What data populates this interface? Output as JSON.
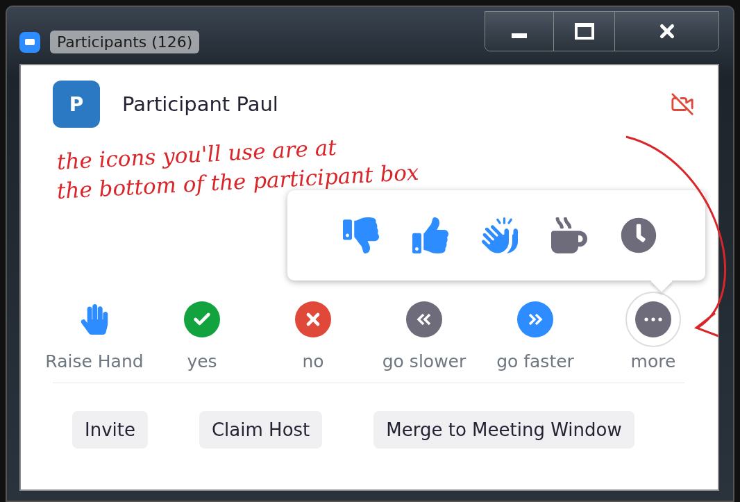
{
  "window": {
    "title": "Participants (126)"
  },
  "participant": {
    "initial": "P",
    "name": "Participant Paul"
  },
  "annotation": {
    "lines": [
      "the icons you'll use are at",
      "the bottom of the participant box"
    ]
  },
  "reactions": [
    {
      "kind": "thumbs-down",
      "color": "#2d8cff"
    },
    {
      "kind": "thumbs-up",
      "color": "#2d8cff"
    },
    {
      "kind": "clap",
      "color": "#2d8cff"
    },
    {
      "kind": "coffee",
      "color": "#6e6c7b"
    },
    {
      "kind": "clock",
      "color": "#6e6c7b"
    }
  ],
  "feedback": [
    {
      "kind": "hand",
      "label": "Raise Hand",
      "color": "#2d8cff"
    },
    {
      "kind": "check",
      "label": "yes",
      "color": "#12a23e"
    },
    {
      "kind": "cross",
      "label": "no",
      "color": "#e0493a"
    },
    {
      "kind": "slower",
      "label": "go slower",
      "color": "#6e6c7b"
    },
    {
      "kind": "faster",
      "label": "go faster",
      "color": "#2d8cff"
    },
    {
      "kind": "more",
      "label": "more",
      "color": "#6e6c7b"
    }
  ],
  "buttons": [
    "Invite",
    "Claim Host",
    "Merge to Meeting Window"
  ]
}
